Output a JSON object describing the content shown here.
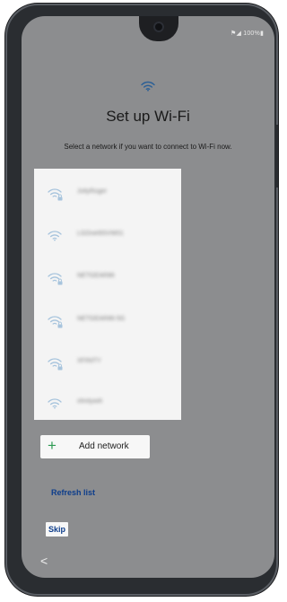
{
  "status_bar": {
    "text": "⚑◢ 100%▮"
  },
  "header": {
    "title": "Set up Wi-Fi",
    "subtitle": "Select a network if you want to connect to Wi-Fi now."
  },
  "networks": [
    {
      "name": "JollyRoger",
      "secured": true
    },
    {
      "name": "LGDnet9SVW01",
      "secured": false
    },
    {
      "name": "NETGEAR86",
      "secured": true
    },
    {
      "name": "NETGEAR86-5G",
      "secured": true
    },
    {
      "name": "XFINITY",
      "secured": true
    },
    {
      "name": "xfinitywifi",
      "secured": false
    }
  ],
  "actions": {
    "add_network_label": "Add network",
    "refresh_label": "Refresh list",
    "skip_label": "Skip"
  },
  "navigation": {
    "back_symbol": "<"
  },
  "colors": {
    "screen_background": "#8c8d8f",
    "list_background": "#f4f4f4",
    "plus_green": "#2e9b53",
    "link_blue": "#0d3d8b",
    "wifi_icon_blue": "#a7c4dd"
  }
}
